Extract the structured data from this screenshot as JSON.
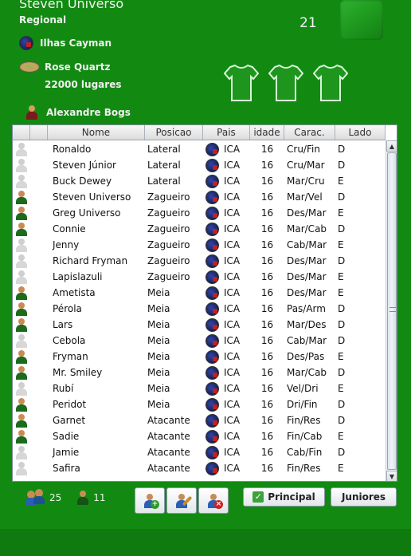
{
  "club": {
    "name": "Steven Universo",
    "level": "Regional",
    "score": "21",
    "country": "Ilhas Cayman",
    "stadium": "Rose Quartz",
    "capacity": "22000 lugares",
    "coach": "Alexandre Bogs"
  },
  "colors": {
    "background": "#128a12",
    "shirt": "#1e961e"
  },
  "table": {
    "headers": [
      "",
      "",
      "Nome",
      "Posicao",
      "Pais",
      "idade",
      "Carac.",
      "Lado"
    ],
    "rows": [
      {
        "on": false,
        "nome": "Ronaldo",
        "pos": "Lateral",
        "pais": "ICA",
        "idade": "16",
        "carac": "Cru/Fin",
        "lado": "D"
      },
      {
        "on": false,
        "nome": "Steven Júnior",
        "pos": "Lateral",
        "pais": "ICA",
        "idade": "16",
        "carac": "Cru/Mar",
        "lado": "D"
      },
      {
        "on": false,
        "nome": "Buck Dewey",
        "pos": "Lateral",
        "pais": "ICA",
        "idade": "16",
        "carac": "Mar/Cru",
        "lado": "E"
      },
      {
        "on": true,
        "nome": "Steven Universo",
        "pos": "Zagueiro",
        "pais": "ICA",
        "idade": "16",
        "carac": "Mar/Vel",
        "lado": "D"
      },
      {
        "on": true,
        "nome": "Greg Universo",
        "pos": "Zagueiro",
        "pais": "ICA",
        "idade": "16",
        "carac": "Des/Mar",
        "lado": "E"
      },
      {
        "on": true,
        "nome": "Connie",
        "pos": "Zagueiro",
        "pais": "ICA",
        "idade": "16",
        "carac": "Mar/Cab",
        "lado": "D"
      },
      {
        "on": false,
        "nome": "Jenny",
        "pos": "Zagueiro",
        "pais": "ICA",
        "idade": "16",
        "carac": "Cab/Mar",
        "lado": "E"
      },
      {
        "on": false,
        "nome": "Richard Fryman",
        "pos": "Zagueiro",
        "pais": "ICA",
        "idade": "16",
        "carac": "Des/Mar",
        "lado": "D"
      },
      {
        "on": false,
        "nome": "Lapislazuli",
        "pos": "Zagueiro",
        "pais": "ICA",
        "idade": "16",
        "carac": "Des/Mar",
        "lado": "E"
      },
      {
        "on": true,
        "nome": "Ametista",
        "pos": "Meia",
        "pais": "ICA",
        "idade": "16",
        "carac": "Des/Mar",
        "lado": "E"
      },
      {
        "on": true,
        "nome": "Pérola",
        "pos": "Meia",
        "pais": "ICA",
        "idade": "16",
        "carac": "Pas/Arm",
        "lado": "D"
      },
      {
        "on": true,
        "nome": "Lars",
        "pos": "Meia",
        "pais": "ICA",
        "idade": "16",
        "carac": "Mar/Des",
        "lado": "D"
      },
      {
        "on": false,
        "nome": "Cebola",
        "pos": "Meia",
        "pais": "ICA",
        "idade": "16",
        "carac": "Cab/Mar",
        "lado": "D"
      },
      {
        "on": true,
        "nome": "Fryman",
        "pos": "Meia",
        "pais": "ICA",
        "idade": "16",
        "carac": "Des/Pas",
        "lado": "E"
      },
      {
        "on": true,
        "nome": "Mr. Smiley",
        "pos": "Meia",
        "pais": "ICA",
        "idade": "16",
        "carac": "Mar/Cab",
        "lado": "D"
      },
      {
        "on": false,
        "nome": "Rubí",
        "pos": "Meia",
        "pais": "ICA",
        "idade": "16",
        "carac": "Vel/Dri",
        "lado": "E"
      },
      {
        "on": true,
        "nome": "Peridot",
        "pos": "Meia",
        "pais": "ICA",
        "idade": "16",
        "carac": "Dri/Fin",
        "lado": "D"
      },
      {
        "on": true,
        "nome": "Garnet",
        "pos": "Atacante",
        "pais": "ICA",
        "idade": "16",
        "carac": "Fin/Res",
        "lado": "D"
      },
      {
        "on": true,
        "nome": "Sadie",
        "pos": "Atacante",
        "pais": "ICA",
        "idade": "16",
        "carac": "Fin/Cab",
        "lado": "E"
      },
      {
        "on": false,
        "nome": "Jamie",
        "pos": "Atacante",
        "pais": "ICA",
        "idade": "16",
        "carac": "Cab/Fin",
        "lado": "D"
      },
      {
        "on": false,
        "nome": "Safira",
        "pos": "Atacante",
        "pais": "ICA",
        "idade": "16",
        "carac": "Fin/Res",
        "lado": "E"
      }
    ]
  },
  "footer": {
    "total_players": "25",
    "selected_players": "11",
    "principal_label": "Principal",
    "juniores_label": "Juniores"
  }
}
